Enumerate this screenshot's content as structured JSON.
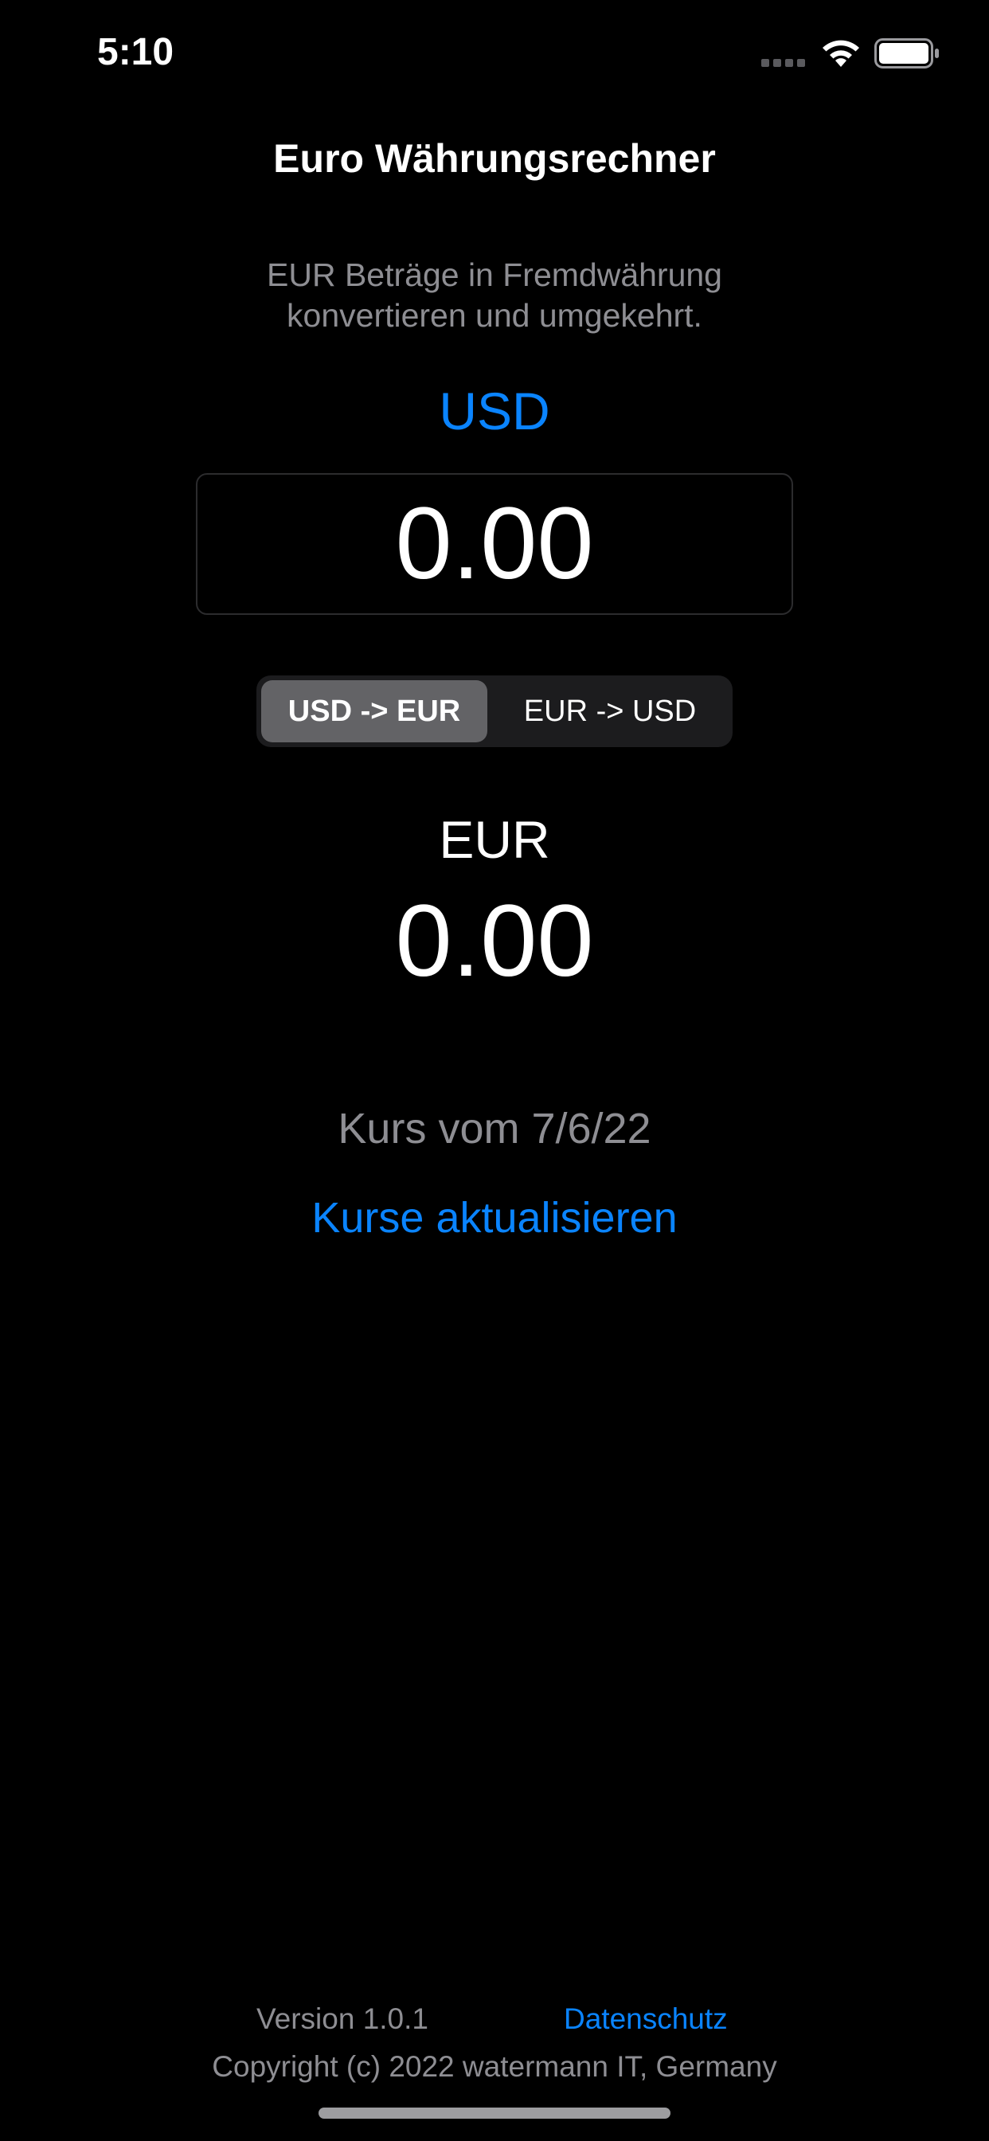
{
  "status_bar": {
    "time": "5:10"
  },
  "header": {
    "title": "Euro Währungsrechner",
    "subtitle_line1": "EUR Beträge in Fremdwährung",
    "subtitle_line2": "konvertieren und umgekehrt."
  },
  "converter": {
    "source_currency": "USD",
    "input_value": "0.00",
    "direction_options": [
      "USD -> EUR",
      "EUR -> USD"
    ],
    "selected_direction": "USD -> EUR",
    "target_currency": "EUR",
    "result_value": "0.00"
  },
  "rates": {
    "date_label": "Kurs vom 7/6/22",
    "refresh_label": "Kurse aktualisieren"
  },
  "footer": {
    "version": "Version 1.0.1",
    "privacy_link": "Datenschutz",
    "copyright": "Copyright (c) 2022 watermann IT, Germany"
  },
  "colors": {
    "background": "#000000",
    "accent": "#0a84ff",
    "secondary_text": "#8e8e93",
    "segment_selected": "#636366",
    "segment_background": "#1c1c1e"
  },
  "icons": [
    "cellular-signal-icon",
    "wifi-icon",
    "battery-icon"
  ]
}
